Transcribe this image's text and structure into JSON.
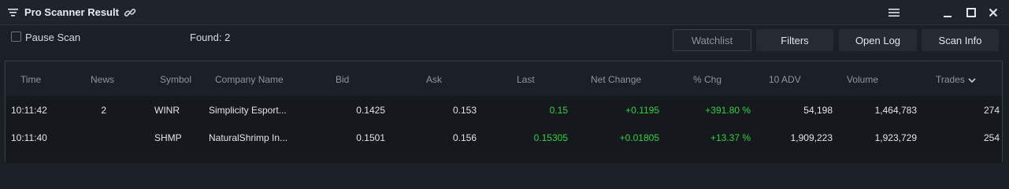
{
  "window": {
    "title": "Pro Scanner Result"
  },
  "toolbar": {
    "pause_label": "Pause Scan",
    "pause_checked": false,
    "found_label": "Found: 2",
    "buttons": {
      "watchlist": "Watchlist",
      "filters": "Filters",
      "open_log": "Open Log",
      "scan_info": "Scan Info"
    }
  },
  "table": {
    "columns": [
      "Time",
      "News",
      "Symbol",
      "Company Name",
      "Bid",
      "Ask",
      "Last",
      "Net Change",
      "% Chg",
      "10 ADV",
      "Volume",
      "Trades"
    ],
    "sort_column": "Trades",
    "rows": [
      {
        "time": "10:11:42",
        "news": "2",
        "symbol": "WINR",
        "company": "Simplicity Esport...",
        "bid": "0.1425",
        "ask": "0.153",
        "last": "0.15",
        "net_change": "+0.1195",
        "pct_chg": "+391.80 %",
        "adv10": "54,198",
        "volume": "1,464,783",
        "trades": "274"
      },
      {
        "time": "10:11:40",
        "news": "",
        "symbol": "SHMP",
        "company": "NaturalShrimp In...",
        "bid": "0.1501",
        "ask": "0.156",
        "last": "0.15305",
        "net_change": "+0.01805",
        "pct_chg": "+13.37 %",
        "adv10": "1,909,223",
        "volume": "1,923,729",
        "trades": "254"
      }
    ]
  },
  "colors": {
    "positive": "#2fd13d",
    "background": "#1b1f26",
    "row_background": "#15181d"
  }
}
